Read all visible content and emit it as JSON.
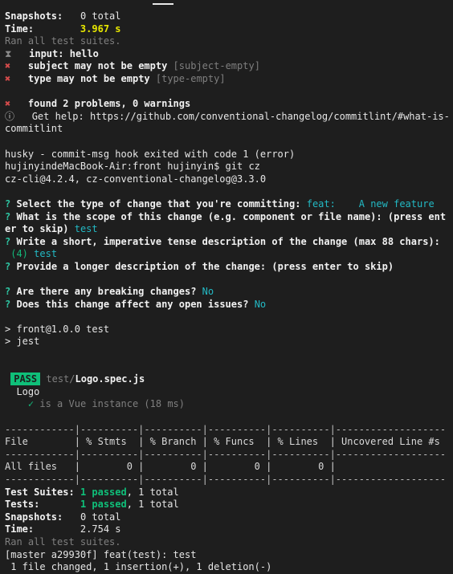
{
  "window": {
    "title": "Terminal",
    "background_color": "#1e1e1e",
    "tab_indicator": "tab-underline"
  },
  "theme": {
    "foreground": "#e6e6e6",
    "dim": "#7f7f7f",
    "red": "#d44b4b",
    "green": "#0fbf79",
    "yellow": "#e8e800",
    "cyan": "#23b9c4"
  },
  "jest_first_run": {
    "snapshots_label": "Snapshots:",
    "snapshots_value": "0 total",
    "time_label": "Time:",
    "time_value": "3.967 s",
    "ran_all": "Ran all test suites."
  },
  "commitlint": {
    "input_icon": "hourglass-icon",
    "input_label": "input:",
    "input_value": "hello",
    "errors": [
      {
        "icon": "cross-icon",
        "message": "subject may not be empty",
        "rule": "[subject-empty]"
      },
      {
        "icon": "cross-icon",
        "message": "type may not be empty",
        "rule": "[type-empty]"
      }
    ],
    "summary_icon": "cross-icon",
    "summary": "found 2 problems, 0 warnings",
    "help_icon": "info-icon",
    "help_line1": "Get help: https://github.com/conventional-changelog/commitlint/#what-is-",
    "help_line2": "commitlint"
  },
  "husky": {
    "message": "husky - commit-msg hook exited with code 1 (error)"
  },
  "shell": {
    "prompt": "hujinyindeMacBook-Air:front hujinyin$",
    "command": "git cz"
  },
  "commitizen": {
    "version_line": "cz-cli@4.2.4, cz-conventional-changelog@3.3.0",
    "prompts": [
      {
        "marker": "?",
        "question": "Select the type of change that you're committing:",
        "answer": "feat:",
        "answer_desc": "A new feature"
      },
      {
        "marker": "?",
        "question_line1": "What is the scope of this change (e.g. component or file name): (press ent",
        "question_line2": "er to skip)",
        "answer": "test"
      },
      {
        "marker": "?",
        "question": "Write a short, imperative tense description of the change (max 88 chars):",
        "counter": "(4)",
        "answer": "test"
      },
      {
        "marker": "?",
        "question": "Provide a longer description of the change: (press enter to skip)",
        "answer": ""
      },
      {
        "marker": "?",
        "question": "Are there any breaking changes?",
        "answer": "No"
      },
      {
        "marker": "?",
        "question": "Does this change affect any open issues?",
        "answer": "No"
      }
    ]
  },
  "npm_script": {
    "line1": "> front@1.0.0 test",
    "line2": "> jest"
  },
  "jest_second_run": {
    "badge": "PASS",
    "path_prefix": "test/",
    "path_file": "Logo.spec.js",
    "suite_name": "Logo",
    "check_icon": "check-icon",
    "test_name": "is a Vue instance (18 ms)"
  },
  "coverage_table": {
    "separator": "------------|----------|----------|----------|----------|-------------------",
    "headers": [
      "File",
      "% Stmts",
      "% Branch",
      "% Funcs",
      "% Lines",
      "Uncovered Line #s"
    ],
    "header_row": "File        | % Stmts  | % Branch | % Funcs  | % Lines  | Uncovered Line #s ",
    "rows": [
      {
        "raw": "All files   |        0 |        0 |        0 |        0 |                   ",
        "file": "All files",
        "stmts": "0",
        "branch": "0",
        "funcs": "0",
        "lines": "0",
        "uncovered": ""
      }
    ]
  },
  "jest_summary": {
    "suites_label": "Test Suites:",
    "suites_passed": "1 passed",
    "suites_rest": ", 1 total",
    "tests_label": "Tests:",
    "tests_passed": "1 passed",
    "tests_rest": ", 1 total",
    "snapshots_label": "Snapshots:",
    "snapshots_value": "0 total",
    "time_label": "Time:",
    "time_value": "2.754 s",
    "ran_all": "Ran all test suites."
  },
  "git_commit": {
    "line1": "[master a29930f] feat(test): test",
    "line2": " 1 file changed, 1 insertion(+), 1 deletion(-)"
  }
}
